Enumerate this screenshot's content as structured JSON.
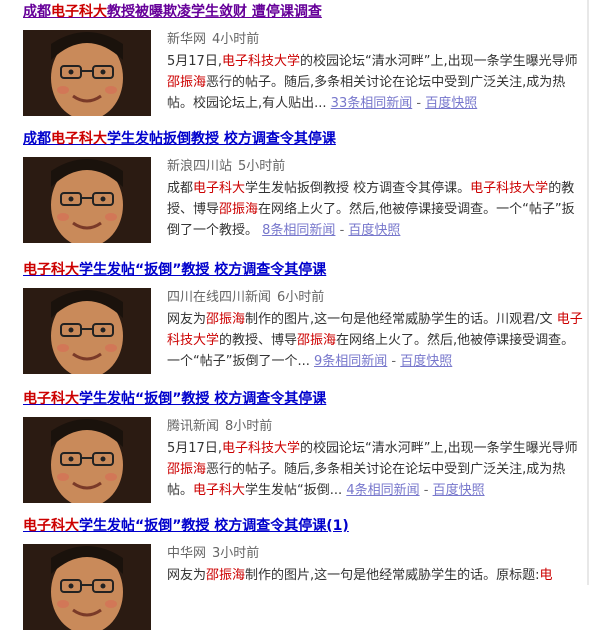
{
  "results": [
    {
      "title": {
        "pre": "成都",
        "em": "电子科大",
        "post": "教授被曝欺凌学生敛财 遭停课调查"
      },
      "source": "新华网",
      "time": "4小时前",
      "snippet": [
        {
          "t": "5月17日,"
        },
        {
          "e": "电子科技大学"
        },
        {
          "t": "的校园论坛“清水河畔”上,出现一条学生曝光导师"
        },
        {
          "e": "邵振海"
        },
        {
          "t": "恶行的帖子。随后,多条相关讨论在论坛中受到广泛关注,成为热帖。校园论坛上,有人贴出..."
        }
      ],
      "related": "33条相同新闻",
      "snapshot": "百度快照"
    },
    {
      "title": {
        "pre": "成都",
        "em": "电子科大",
        "post": "学生发帖扳倒教授 校方调查令其停课"
      },
      "source": "新浪四川站",
      "time": "5小时前",
      "snippet": [
        {
          "t": "成都"
        },
        {
          "e": "电子科大"
        },
        {
          "t": "学生发帖扳倒教授 校方调查令其停课。"
        },
        {
          "e": "电子科技大学"
        },
        {
          "t": "的教授、博导"
        },
        {
          "e": "邵振海"
        },
        {
          "t": "在网络上火了。然后,他被停课接受调查。一个“帖子”扳倒了一个教授。"
        }
      ],
      "related": "8条相同新闻",
      "snapshot": "百度快照"
    },
    {
      "title": {
        "pre": "",
        "em": "电子科大",
        "post": "学生发帖“扳倒”教授 校方调查令其停课"
      },
      "source": "四川在线四川新闻",
      "time": "6小时前",
      "snippet": [
        {
          "t": "网友为"
        },
        {
          "e": "邵振海"
        },
        {
          "t": "制作的图片,这一句是他经常威胁学生的话。川观君/文 "
        },
        {
          "e": "电子科技大学"
        },
        {
          "t": "的教授、博导"
        },
        {
          "e": "邵振海"
        },
        {
          "t": "在网络上火了。然后,他被停课接受调查。一个“帖子”扳倒了一个..."
        }
      ],
      "related": "9条相同新闻",
      "snapshot": "百度快照"
    },
    {
      "title": {
        "pre": "",
        "em": "电子科大",
        "post": "学生发帖“扳倒”教授 校方调查令其停课"
      },
      "source": "腾讯新闻",
      "time": "8小时前",
      "snippet": [
        {
          "t": "5月17日,"
        },
        {
          "e": "电子科技大学"
        },
        {
          "t": "的校园论坛“清水河畔”上,出现一条学生曝光导师"
        },
        {
          "e": "邵振海"
        },
        {
          "t": "恶行的帖子。随后,多条相关讨论在论坛中受到广泛关注,成为热帖。"
        },
        {
          "e": "电子科大"
        },
        {
          "t": "学生发帖“扳倒..."
        }
      ],
      "related": "4条相同新闻",
      "snapshot": "百度快照"
    },
    {
      "title": {
        "pre": "",
        "em": "电子科大",
        "post": "学生发帖“扳倒”教授 校方调查令其停课(1)"
      },
      "source": "中华网",
      "time": "3小时前",
      "snippet": [
        {
          "t": "网友为"
        },
        {
          "e": "邵振海"
        },
        {
          "t": "制作的图片,这一句是他经常威胁学生的话。原标题:"
        },
        {
          "e": "电"
        }
      ],
      "related": "",
      "snapshot": ""
    }
  ],
  "colors": {
    "visited": "#660099",
    "link": "#0000cc",
    "highlight": "#cc0000",
    "related_link": "#7777cc"
  }
}
